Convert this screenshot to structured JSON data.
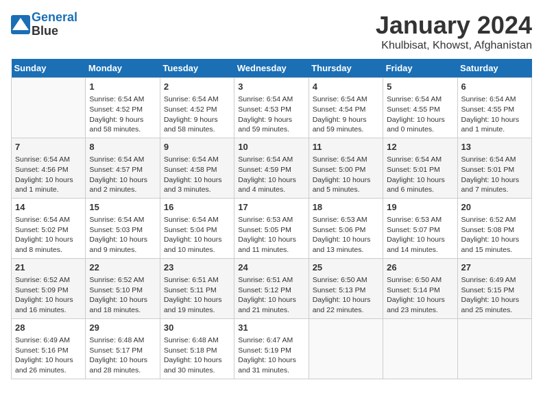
{
  "header": {
    "logo_line1": "General",
    "logo_line2": "Blue",
    "month": "January 2024",
    "location": "Khulbisat, Khowst, Afghanistan"
  },
  "weekdays": [
    "Sunday",
    "Monday",
    "Tuesday",
    "Wednesday",
    "Thursday",
    "Friday",
    "Saturday"
  ],
  "weeks": [
    [
      {
        "day": "",
        "info": ""
      },
      {
        "day": "1",
        "info": "Sunrise: 6:54 AM\nSunset: 4:52 PM\nDaylight: 9 hours\nand 58 minutes."
      },
      {
        "day": "2",
        "info": "Sunrise: 6:54 AM\nSunset: 4:52 PM\nDaylight: 9 hours\nand 58 minutes."
      },
      {
        "day": "3",
        "info": "Sunrise: 6:54 AM\nSunset: 4:53 PM\nDaylight: 9 hours\nand 59 minutes."
      },
      {
        "day": "4",
        "info": "Sunrise: 6:54 AM\nSunset: 4:54 PM\nDaylight: 9 hours\nand 59 minutes."
      },
      {
        "day": "5",
        "info": "Sunrise: 6:54 AM\nSunset: 4:55 PM\nDaylight: 10 hours\nand 0 minutes."
      },
      {
        "day": "6",
        "info": "Sunrise: 6:54 AM\nSunset: 4:55 PM\nDaylight: 10 hours\nand 1 minute."
      }
    ],
    [
      {
        "day": "7",
        "info": "Sunrise: 6:54 AM\nSunset: 4:56 PM\nDaylight: 10 hours\nand 1 minute."
      },
      {
        "day": "8",
        "info": "Sunrise: 6:54 AM\nSunset: 4:57 PM\nDaylight: 10 hours\nand 2 minutes."
      },
      {
        "day": "9",
        "info": "Sunrise: 6:54 AM\nSunset: 4:58 PM\nDaylight: 10 hours\nand 3 minutes."
      },
      {
        "day": "10",
        "info": "Sunrise: 6:54 AM\nSunset: 4:59 PM\nDaylight: 10 hours\nand 4 minutes."
      },
      {
        "day": "11",
        "info": "Sunrise: 6:54 AM\nSunset: 5:00 PM\nDaylight: 10 hours\nand 5 minutes."
      },
      {
        "day": "12",
        "info": "Sunrise: 6:54 AM\nSunset: 5:01 PM\nDaylight: 10 hours\nand 6 minutes."
      },
      {
        "day": "13",
        "info": "Sunrise: 6:54 AM\nSunset: 5:01 PM\nDaylight: 10 hours\nand 7 minutes."
      }
    ],
    [
      {
        "day": "14",
        "info": "Sunrise: 6:54 AM\nSunset: 5:02 PM\nDaylight: 10 hours\nand 8 minutes."
      },
      {
        "day": "15",
        "info": "Sunrise: 6:54 AM\nSunset: 5:03 PM\nDaylight: 10 hours\nand 9 minutes."
      },
      {
        "day": "16",
        "info": "Sunrise: 6:54 AM\nSunset: 5:04 PM\nDaylight: 10 hours\nand 10 minutes."
      },
      {
        "day": "17",
        "info": "Sunrise: 6:53 AM\nSunset: 5:05 PM\nDaylight: 10 hours\nand 11 minutes."
      },
      {
        "day": "18",
        "info": "Sunrise: 6:53 AM\nSunset: 5:06 PM\nDaylight: 10 hours\nand 13 minutes."
      },
      {
        "day": "19",
        "info": "Sunrise: 6:53 AM\nSunset: 5:07 PM\nDaylight: 10 hours\nand 14 minutes."
      },
      {
        "day": "20",
        "info": "Sunrise: 6:52 AM\nSunset: 5:08 PM\nDaylight: 10 hours\nand 15 minutes."
      }
    ],
    [
      {
        "day": "21",
        "info": "Sunrise: 6:52 AM\nSunset: 5:09 PM\nDaylight: 10 hours\nand 16 minutes."
      },
      {
        "day": "22",
        "info": "Sunrise: 6:52 AM\nSunset: 5:10 PM\nDaylight: 10 hours\nand 18 minutes."
      },
      {
        "day": "23",
        "info": "Sunrise: 6:51 AM\nSunset: 5:11 PM\nDaylight: 10 hours\nand 19 minutes."
      },
      {
        "day": "24",
        "info": "Sunrise: 6:51 AM\nSunset: 5:12 PM\nDaylight: 10 hours\nand 21 minutes."
      },
      {
        "day": "25",
        "info": "Sunrise: 6:50 AM\nSunset: 5:13 PM\nDaylight: 10 hours\nand 22 minutes."
      },
      {
        "day": "26",
        "info": "Sunrise: 6:50 AM\nSunset: 5:14 PM\nDaylight: 10 hours\nand 23 minutes."
      },
      {
        "day": "27",
        "info": "Sunrise: 6:49 AM\nSunset: 5:15 PM\nDaylight: 10 hours\nand 25 minutes."
      }
    ],
    [
      {
        "day": "28",
        "info": "Sunrise: 6:49 AM\nSunset: 5:16 PM\nDaylight: 10 hours\nand 26 minutes."
      },
      {
        "day": "29",
        "info": "Sunrise: 6:48 AM\nSunset: 5:17 PM\nDaylight: 10 hours\nand 28 minutes."
      },
      {
        "day": "30",
        "info": "Sunrise: 6:48 AM\nSunset: 5:18 PM\nDaylight: 10 hours\nand 30 minutes."
      },
      {
        "day": "31",
        "info": "Sunrise: 6:47 AM\nSunset: 5:19 PM\nDaylight: 10 hours\nand 31 minutes."
      },
      {
        "day": "",
        "info": ""
      },
      {
        "day": "",
        "info": ""
      },
      {
        "day": "",
        "info": ""
      }
    ]
  ]
}
